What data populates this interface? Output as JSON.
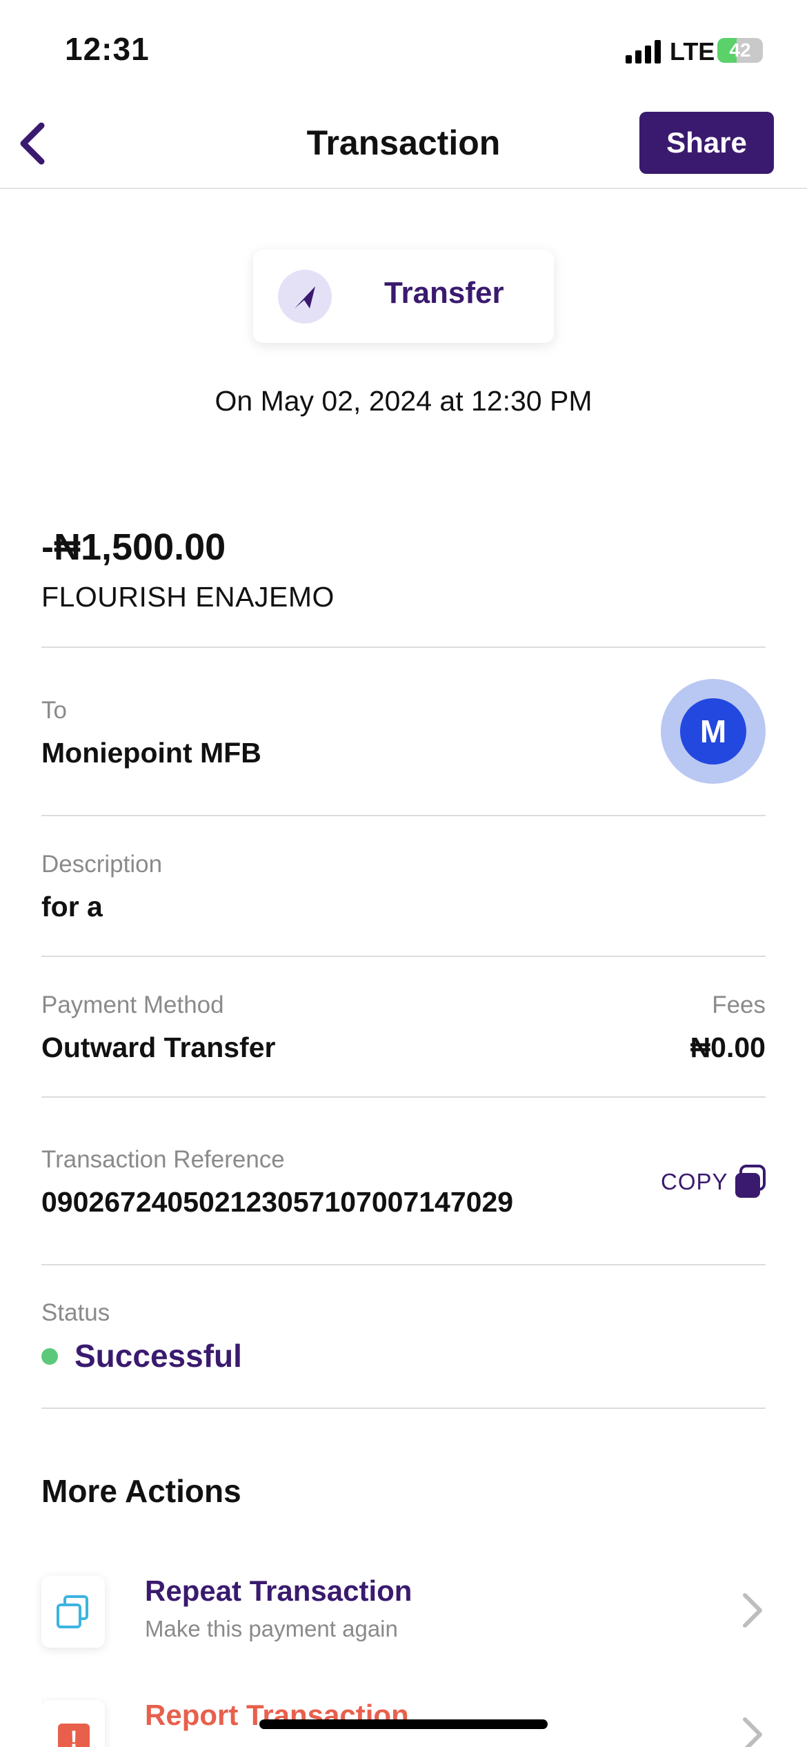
{
  "status_bar": {
    "time": "12:31",
    "network": "LTE",
    "battery": "42",
    "battery_level": 0.42
  },
  "header": {
    "title": "Transaction",
    "share_label": "Share",
    "back_icon": "chevron-left-icon"
  },
  "type_card": {
    "label": "Transfer",
    "icon": "send-arrow-icon"
  },
  "date_line": "On May 02, 2024 at 12:30 PM",
  "summary": {
    "amount": "-₦1,500.00",
    "party": "FLOURISH ENAJEMO"
  },
  "to": {
    "label": "To",
    "value": "Moniepoint MFB",
    "avatar_letter": "M"
  },
  "description": {
    "label": "Description",
    "value": "for a"
  },
  "payment_method": {
    "label": "Payment Method",
    "value": "Outward Transfer"
  },
  "fees": {
    "label": "Fees",
    "value": "₦0.00"
  },
  "reference": {
    "label": "Transaction Reference",
    "value": "090267240502123057107007147029",
    "copy_label": "COPY"
  },
  "status": {
    "label": "Status",
    "value": "Successful"
  },
  "more_actions": {
    "title": "More Actions",
    "items": [
      {
        "title": "Repeat Transaction",
        "subtitle": "Make this payment again",
        "icon": "repeat-icon"
      },
      {
        "title": "Report Transaction",
        "subtitle": "",
        "icon": "alert-icon"
      }
    ]
  },
  "colors": {
    "brand": "#3a1a6e",
    "success": "#5cc97a",
    "danger": "#e8604c",
    "avatar": "#2348e0"
  }
}
